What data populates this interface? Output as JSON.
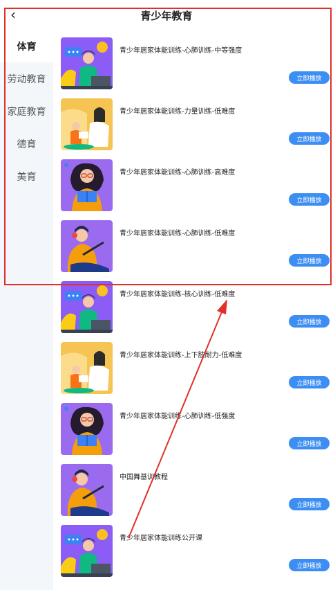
{
  "header": {
    "title": "青少年教育",
    "back_glyph": "‹"
  },
  "sidebar": {
    "items": [
      {
        "label": "体育",
        "active": true
      },
      {
        "label": "劳动教育",
        "active": false
      },
      {
        "label": "家庭教育",
        "active": false
      },
      {
        "label": "德育",
        "active": false
      },
      {
        "label": "美育",
        "active": false
      }
    ]
  },
  "courses": [
    {
      "title": "青少年居家体能训练-心肺训练-中等强度",
      "button": "立即播放",
      "thumb": "girl-laptop-lamp"
    },
    {
      "title": "青少年居家体能训练-力量训练-低难度",
      "button": "立即播放",
      "thumb": "mother-child-reading"
    },
    {
      "title": "青少年居家体能训练-心肺训练-高难度",
      "button": "立即播放",
      "thumb": "girl-reading-book"
    },
    {
      "title": "青少年居家体能训练-心肺训练-低难度",
      "button": "立即播放",
      "thumb": "girl-headphones-pen"
    },
    {
      "title": "青少年居家体能训练-核心训练-低难度",
      "button": "立即播放",
      "thumb": "girl-laptop-lamp"
    },
    {
      "title": "青少年居家体能训练-上下肢耐力-低难度",
      "button": "立即播放",
      "thumb": "mother-child-reading"
    },
    {
      "title": "青少年居家体能训练-心肺训练-低强度",
      "button": "立即播放",
      "thumb": "girl-reading-book"
    },
    {
      "title": "中国舞基训教程",
      "button": "立即播放",
      "thumb": "girl-headphones-pen"
    },
    {
      "title": "青少年居家体能训练公开课",
      "button": "立即播放",
      "thumb": "girl-laptop-lamp"
    }
  ],
  "colors": {
    "accent": "#3d8ef2",
    "annotation": "#e0302a",
    "sidebar_bg": "#f3f6fa"
  }
}
